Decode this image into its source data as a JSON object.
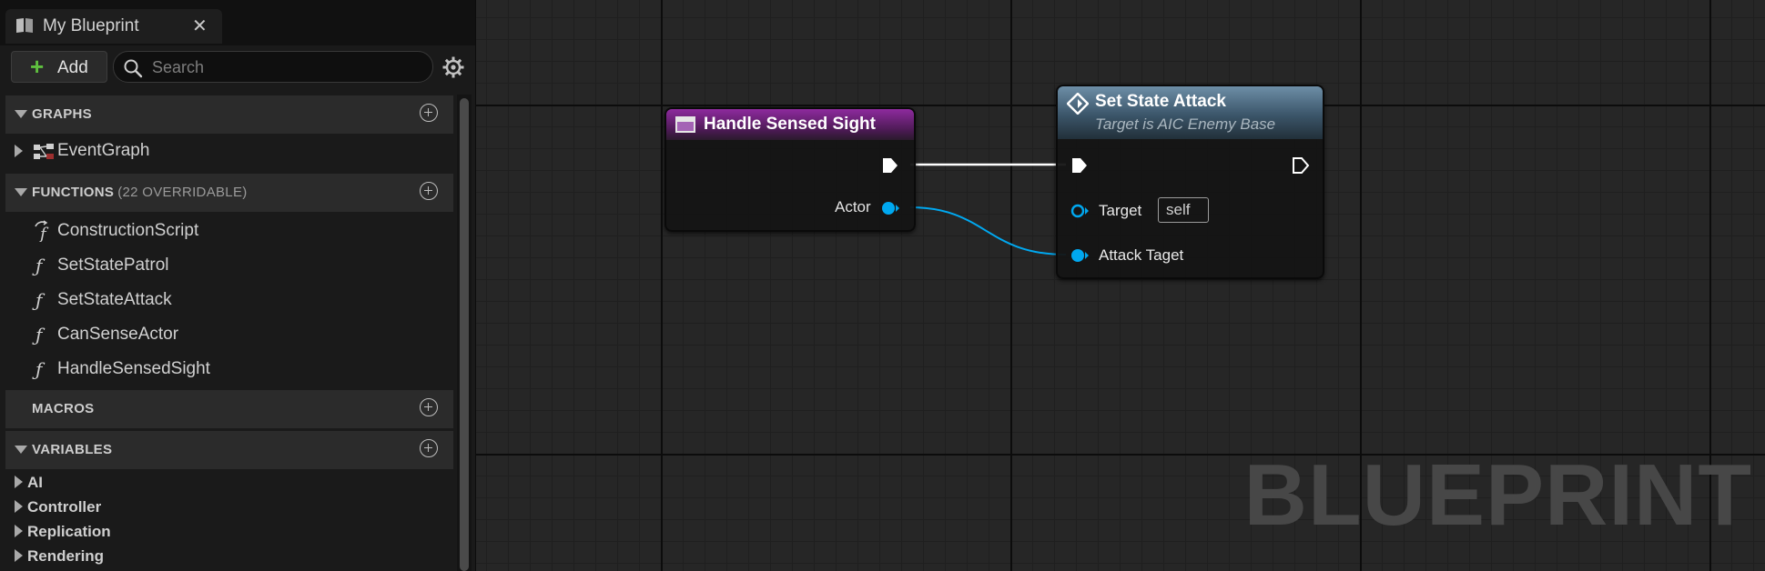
{
  "tab": {
    "title": "My Blueprint",
    "close": "✕",
    "icon": "book-icon"
  },
  "toolbar": {
    "add_label": "Add",
    "search_placeholder": "Search"
  },
  "sections": {
    "graphs": {
      "title": "GRAPHS",
      "items": [
        {
          "label": "EventGraph",
          "icon": "event-graph-icon"
        }
      ]
    },
    "functions": {
      "title": "FUNCTIONS",
      "subtitle": "(22 OVERRIDABLE)",
      "items": [
        {
          "label": "ConstructionScript",
          "icon": "construction-script-icon"
        },
        {
          "label": "SetStatePatrol",
          "icon": "function-icon"
        },
        {
          "label": "SetStateAttack",
          "icon": "function-icon"
        },
        {
          "label": "CanSenseActor",
          "icon": "function-icon"
        },
        {
          "label": "HandleSensedSight",
          "icon": "function-icon"
        }
      ]
    },
    "macros": {
      "title": "MACROS"
    },
    "variables": {
      "title": "VARIABLES",
      "categories": [
        "AI",
        "Controller",
        "Replication",
        "Rendering"
      ]
    }
  },
  "graph": {
    "watermark": "BLUEPRINT",
    "nodes": {
      "handle_sensed_sight": {
        "title": "Handle Sensed Sight",
        "pins": {
          "actor": "Actor"
        }
      },
      "set_state_attack": {
        "title": "Set State Attack",
        "subtitle": "Target is AIC Enemy Base",
        "pins": {
          "target": "Target",
          "target_default": "self",
          "attack_target": "Attack Taget"
        }
      }
    },
    "colors": {
      "event_header": "#8e2a9e",
      "function_header": "#6d8ea7",
      "object_pin": "#00a8f0",
      "exec_wire": "#ffffff",
      "add_plus": "#5fbf3f"
    }
  }
}
